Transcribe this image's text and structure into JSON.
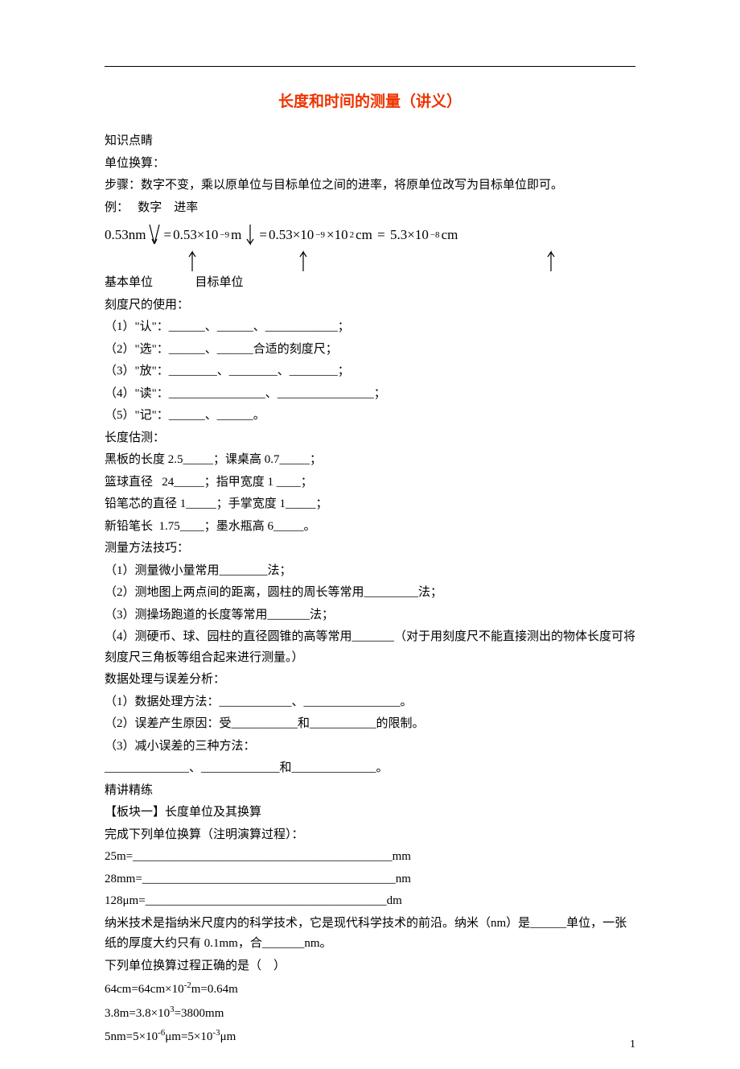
{
  "title": "长度和时间的测量（讲义）",
  "s1": {
    "h": "知识点睛",
    "t1": "单位换算：",
    "t2": "步骤：数字不变，乘以原单位与目标单位之间的进率，将原单位改写为目标单位即可。",
    "t3": "例：   数字    进率",
    "t4": "基本单位              目标单位"
  },
  "eq": {
    "a": "0.53nm",
    "b": "0.53×10",
    "b_exp": "−9",
    "b_u": "m",
    "c": "0.53×10",
    "c_exp": "−9",
    "c2": "×10",
    "c2_exp": "2",
    "c_u": "cm",
    "d": "5.3×10",
    "d_exp": "−8",
    "d_u": "cm"
  },
  "s2": {
    "h": "刻度尺的使用：",
    "l1": "（1）\"认\"：______、______、____________；",
    "l2": "（2）\"选\"：______、______合适的刻度尺；",
    "l3": "（3）\"放\"：________、________、________；",
    "l4": "（4）\"读\"：________________、________________；",
    "l5": "（5）\"记\"：______、______。"
  },
  "s3": {
    "h": "长度估测：",
    "l1": "黑板的长度 2.5_____；课桌高 0.7_____；",
    "l2": "篮球直径   24_____；指甲宽度 1 ____；",
    "l3": "铅笔芯的直径 1_____；手掌宽度 1_____；",
    "l4": "新铅笔长  1.75____；墨水瓶高 6_____。"
  },
  "s4": {
    "h": "测量方法技巧：",
    "l1": "（1）测量微小量常用________法；",
    "l2": "（2）测地图上两点间的距离，圆柱的周长等常用_________法；",
    "l3": "（3）测操场跑道的长度等常用_______法；",
    "l4": "（4）测硬币、球、园柱的直径圆锥的高等常用_______（对于用刻度尺不能直接测出的物体长度可将刻度尺三角板等组合起来进行测量。）"
  },
  "s5": {
    "h": "数据处理与误差分析：",
    "l1": "（1）数据处理方法：____________、________________。",
    "l2": "（2）误差产生原因：受___________和___________的限制。",
    "l3": "（3）减小误差的三种方法：",
    "l4": "______________、_____________和______________。"
  },
  "s6": {
    "h": "精讲精练",
    "t": "【板块一】长度单位及其换算",
    "p1": "完成下列单位换算（注明演算过程）：",
    "l1": "25m=___________________________________________mm",
    "l2": "28mm=__________________________________________nm",
    "l3": "128μm=________________________________________dm",
    "p2": "纳米技术是指纳米尺度内的科学技术，它是现代科学技术的前沿。纳米（nm）是______单位，一张纸的厚度大约只有 0.1mm，合_______nm。",
    "p3": "下列单位换算过程正确的是（    ）",
    "o1a": "64cm=64cm×10",
    "o1b": "m=0.64m",
    "o2a": "3.8m=3.8×10",
    "o2b": "=3800mm",
    "o3a": "5nm=5×10",
    "o3b": "μm=5×10",
    "o3c": "μm"
  },
  "exp": {
    "m2": "-2",
    "p3": "3",
    "m6": "-6",
    "m3": "-3"
  },
  "pagenum": "1"
}
